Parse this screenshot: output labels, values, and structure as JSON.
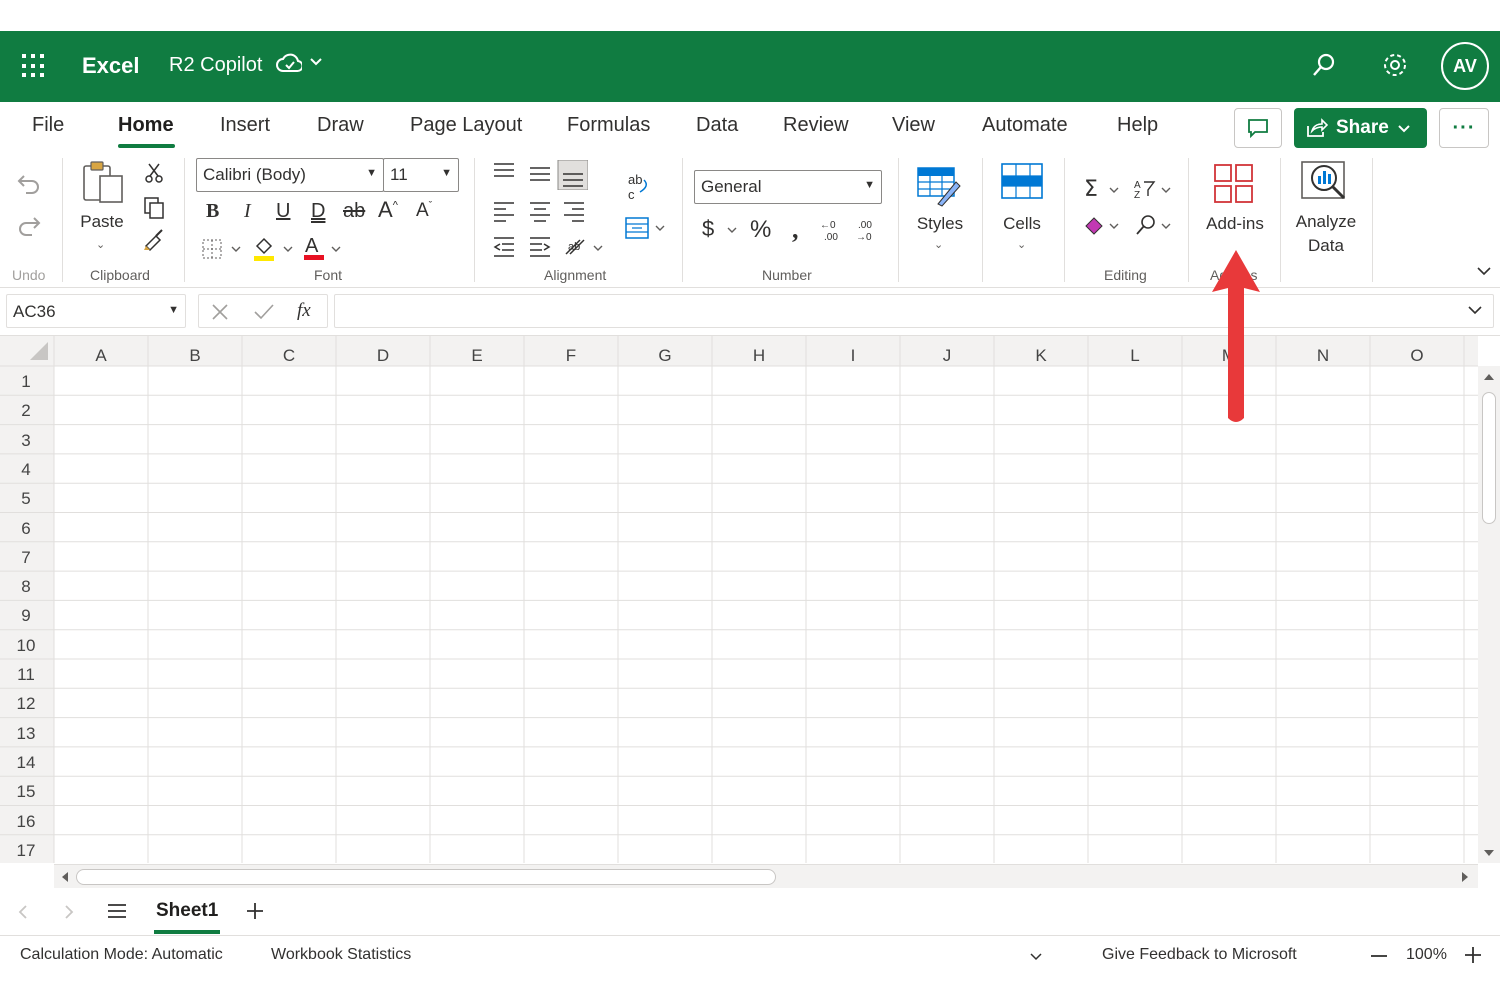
{
  "titlebar": {
    "app_name": "Excel",
    "doc_name": "R2 Copilot",
    "avatar_initials": "AV"
  },
  "tabs": [
    "File",
    "Home",
    "Insert",
    "Draw",
    "Page Layout",
    "Formulas",
    "Data",
    "Review",
    "View",
    "Automate",
    "Help"
  ],
  "active_tab": "Home",
  "share_label": "Share",
  "ribbon": {
    "undo_label": "Undo",
    "paste_label": "Paste",
    "clipboard_label": "Clipboard",
    "font_name": "Calibri (Body)",
    "font_size": "11",
    "font_label": "Font",
    "alignment_label": "Alignment",
    "number_format": "General",
    "number_label": "Number",
    "styles_label": "Styles",
    "cells_label": "Cells",
    "editing_label": "Editing",
    "addins_label": "Add-ins",
    "addins_group_label": "Add-ins",
    "analyze_label_1": "Analyze",
    "analyze_label_2": "Data"
  },
  "formula_bar": {
    "name_box": "AC36",
    "formula": ""
  },
  "grid": {
    "columns": [
      "A",
      "B",
      "C",
      "D",
      "E",
      "F",
      "G",
      "H",
      "I",
      "J",
      "K",
      "L",
      "M",
      "N",
      "O"
    ],
    "rows": [
      "1",
      "2",
      "3",
      "4",
      "5",
      "6",
      "7",
      "8",
      "9",
      "10",
      "11",
      "12",
      "13",
      "14",
      "15",
      "16",
      "17"
    ]
  },
  "sheets": {
    "active": "Sheet1"
  },
  "statusbar": {
    "calc_mode": "Calculation Mode: Automatic",
    "workbook_stats": "Workbook Statistics",
    "feedback": "Give Feedback to Microsoft",
    "zoom": "100%"
  },
  "colors": {
    "brand_green": "#107c41",
    "annotation_red": "#e8393a"
  }
}
